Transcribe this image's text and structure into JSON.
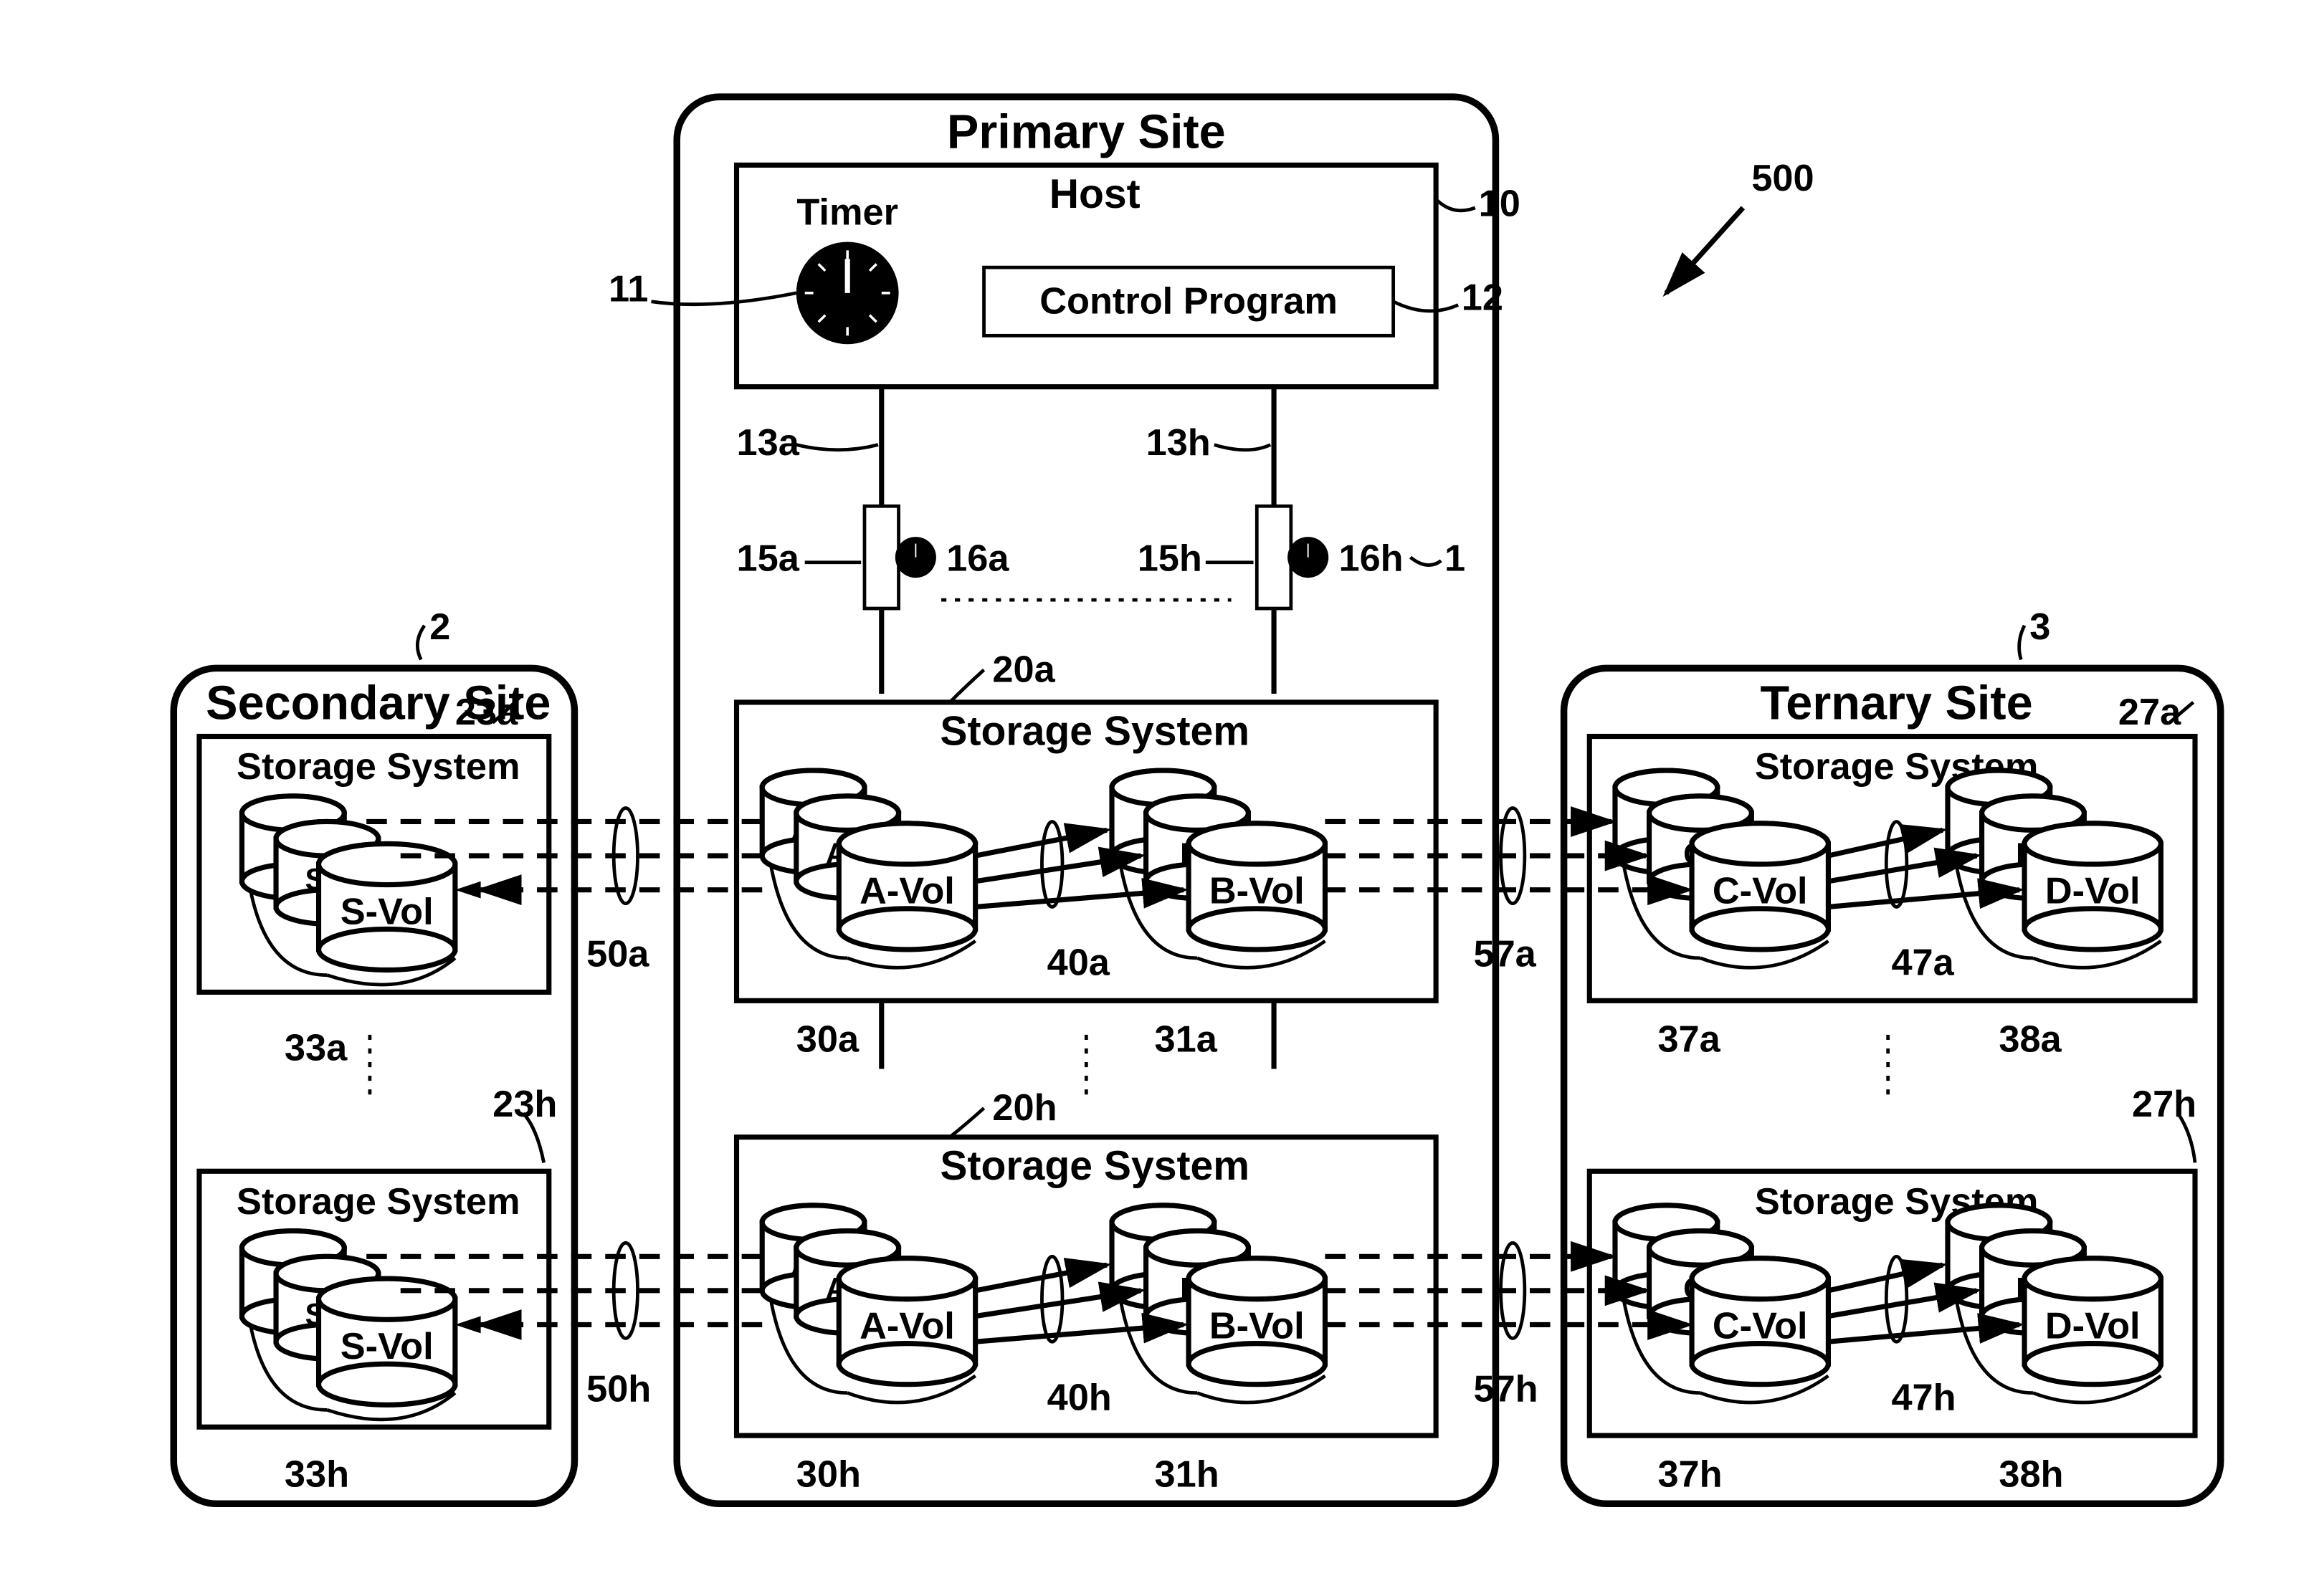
{
  "fig": "500",
  "primary": {
    "title": "Primary Site",
    "host": "Host",
    "timer": "Timer",
    "control": "Control Program",
    "storage": "Storage System",
    "avol": "A-Vol",
    "bvol": "B-Vol",
    "a": "A",
    "b": "B"
  },
  "secondary": {
    "title": "Secondary Site",
    "storage": "Storage System",
    "svol": "S-Vol",
    "s": "S"
  },
  "ternary": {
    "title": "Ternary Site",
    "storage": "Storage System",
    "cvol": "C-Vol",
    "dvol": "D-Vol",
    "c": "C",
    "d": "D"
  },
  "labels": {
    "n1": "1",
    "n2": "2",
    "n3": "3",
    "n10": "10",
    "n11": "11",
    "n12": "12",
    "n13a": "13a",
    "n13h": "13h",
    "n15a": "15a",
    "n15h": "15h",
    "n16a": "16a",
    "n16h": "16h",
    "n20a": "20a",
    "n20h": "20h",
    "n23a": "23a",
    "n23h": "23h",
    "n27a": "27a",
    "n27h": "27h",
    "n30a": "30a",
    "n30h": "30h",
    "n31a": "31a",
    "n31h": "31h",
    "n33a": "33a",
    "n33h": "33h",
    "n37a": "37a",
    "n37h": "37h",
    "n38a": "38a",
    "n38h": "38h",
    "n40a": "40a",
    "n40h": "40h",
    "n47a": "47a",
    "n47h": "47h",
    "n50a": "50a",
    "n50h": "50h",
    "n57a": "57a",
    "n57h": "57h"
  }
}
